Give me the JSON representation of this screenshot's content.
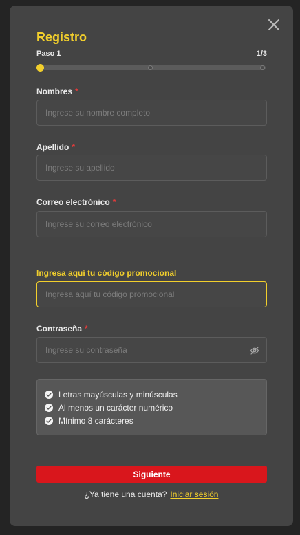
{
  "modal": {
    "title": "Registro",
    "close_icon": "close-icon"
  },
  "step": {
    "label": "Paso 1",
    "counter": "1/3",
    "current": 1,
    "total": 3,
    "progress_fraction": 0.0
  },
  "fields": {
    "nombres": {
      "label": "Nombres",
      "required_mark": "*",
      "placeholder": "Ingrese su nombre completo",
      "value": ""
    },
    "apellido": {
      "label": "Apellido",
      "required_mark": "*",
      "placeholder": "Ingrese su apellido",
      "value": ""
    },
    "correo": {
      "label": "Correo electrónico",
      "required_mark": "*",
      "placeholder": "Ingrese su correo electrónico",
      "value": ""
    },
    "promo": {
      "label": "Ingresa aquí tu código promocional",
      "placeholder": "Ingresa aquí tu código promocional",
      "value": ""
    },
    "contrasena": {
      "label": "Contraseña",
      "required_mark": "*",
      "placeholder": "Ingrese su contraseña",
      "value": "",
      "toggle_icon": "eye-slash-icon"
    }
  },
  "password_rules": [
    {
      "text": "Letras mayúsculas y minúsculas",
      "icon": "check-circle-icon"
    },
    {
      "text": "Al menos un carácter numérico",
      "icon": "check-circle-icon"
    },
    {
      "text": "Mínimo 8 carácteres",
      "icon": "check-circle-icon"
    }
  ],
  "actions": {
    "next_label": "Siguiente",
    "login_prompt": "¿Ya tiene una cuenta?",
    "login_link": "Iniciar sesión"
  },
  "colors": {
    "accent": "#f2cf2c",
    "primary_button": "#d9161c",
    "required": "#e23b3b",
    "panel": "#444444",
    "background": "#242424"
  }
}
